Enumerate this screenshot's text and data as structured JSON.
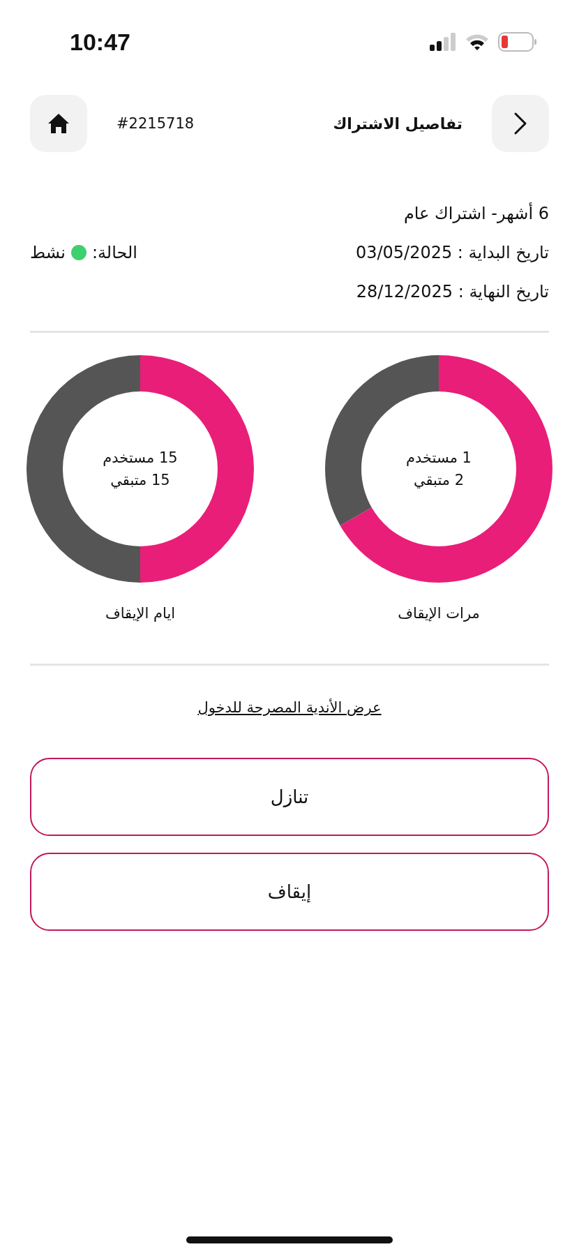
{
  "status_bar": {
    "time": "10:47"
  },
  "header": {
    "title": "تفاصيل الاشتراك",
    "order_number": "#2215718"
  },
  "subscription": {
    "plan": "6 أشهر- اشتراك عام",
    "start_date": "تاريخ البداية : 03/05/2025",
    "end_date": "تاريخ النهاية : 28/12/2025",
    "status_label": "الحالة:",
    "status_value": "نشط"
  },
  "charts": [
    {
      "used_text": "1 مستخدم",
      "remaining_text": "2 متبقي",
      "chart_data": {
        "type": "donut",
        "title": "مرات الإيقاف",
        "values": [
          66.7,
          33.3
        ]
      }
    },
    {
      "used_text": "15 مستخدم",
      "remaining_text": "15 متبقي",
      "chart_data": {
        "type": "donut",
        "title": "ايام الإيقاف",
        "values": [
          50,
          50
        ]
      }
    }
  ],
  "clubs_link": "عرض الأندية المصرحة للدخول",
  "buttons": [
    "تنازل",
    "إيقاف"
  ]
}
